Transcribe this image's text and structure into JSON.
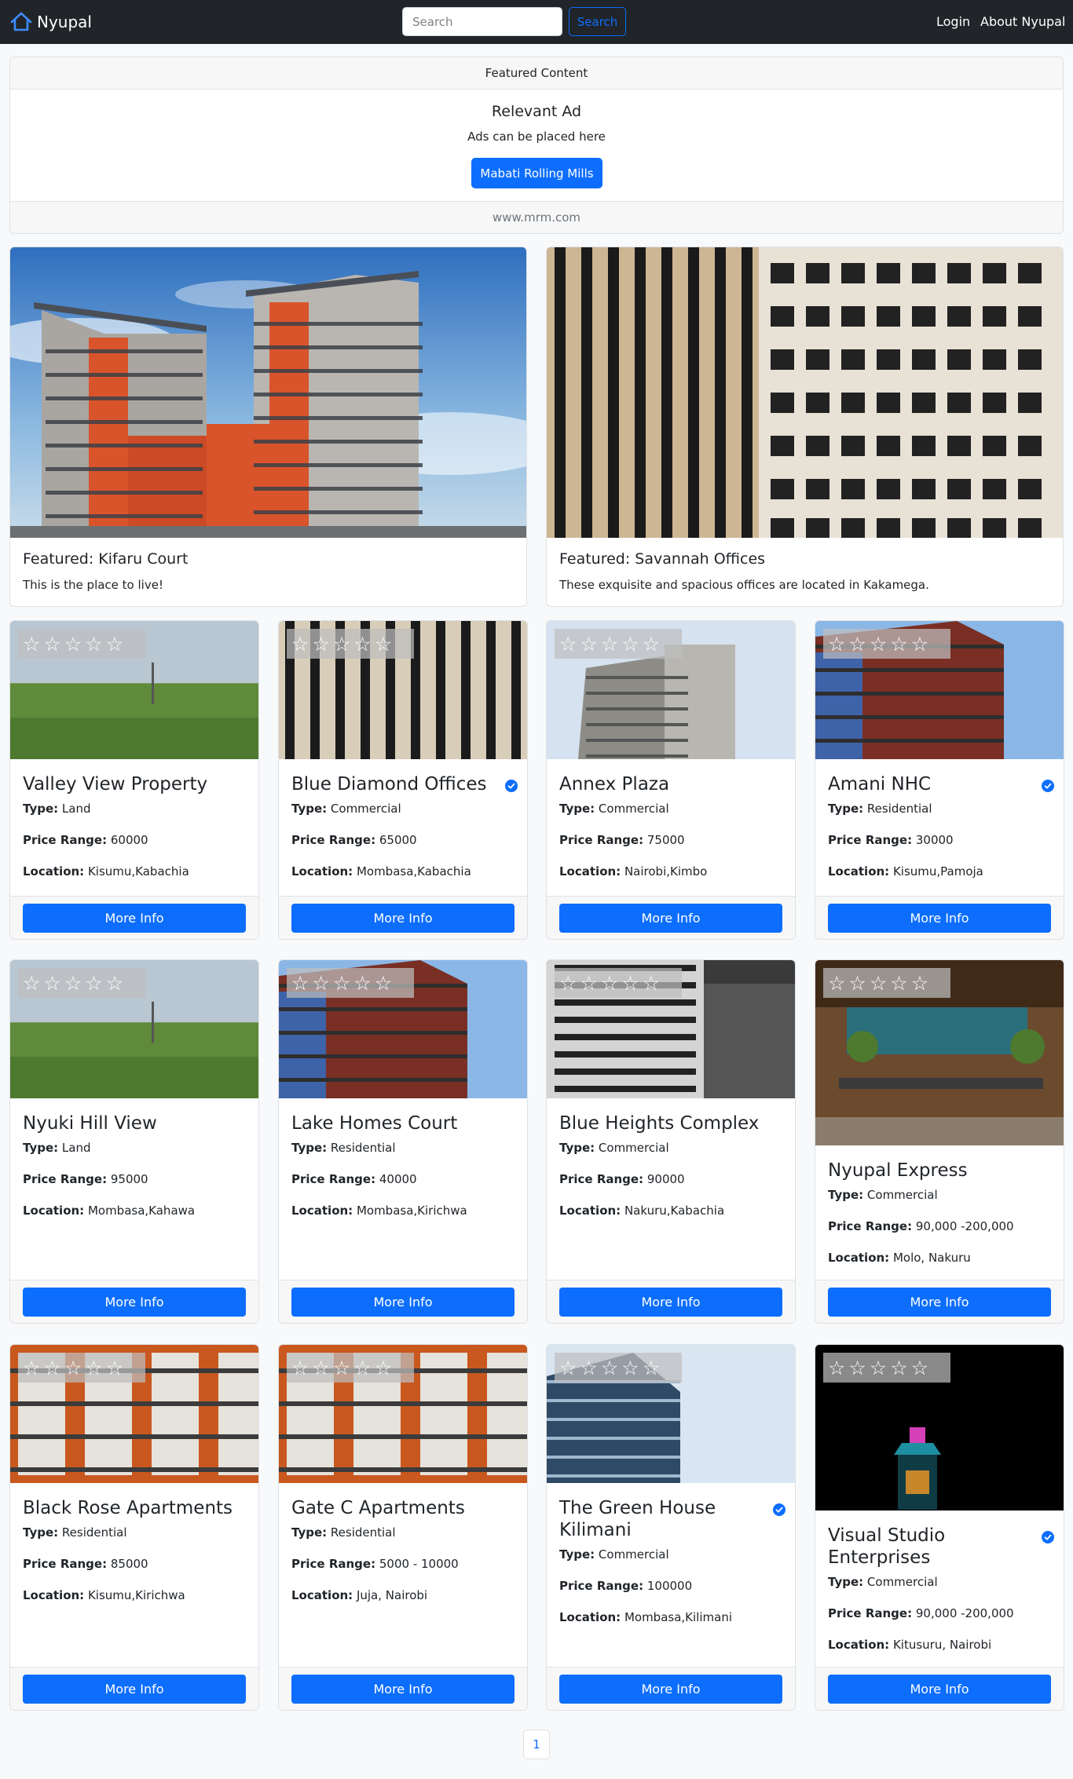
{
  "navbar": {
    "brand": "Nyupal",
    "search_placeholder": "Search",
    "search_button": "Search",
    "login": "Login",
    "about": "About Nyupal"
  },
  "ad": {
    "header": "Featured Content",
    "title": "Relevant Ad",
    "text": "Ads can be placed here",
    "button": "Mabati Rolling Mills",
    "footer": "www.mrm.com"
  },
  "featured": [
    {
      "title": "Featured: Kifaru Court",
      "text": "This is the place to live!"
    },
    {
      "title": "Featured: Savannah Offices",
      "text": "These exquisite and spacious offices are located in Kakamega."
    }
  ],
  "labels": {
    "type": "Type:",
    "price": "Price Range:",
    "location": "Location:",
    "more_info": "More Info"
  },
  "properties": [
    {
      "name": "Valley View Property",
      "type": "Land",
      "price": "60000",
      "location": "Kisumu,Kabachia",
      "verified": false
    },
    {
      "name": "Blue Diamond Offices",
      "type": "Commercial",
      "price": "65000",
      "location": "Mombasa,Kabachia",
      "verified": true
    },
    {
      "name": "Annex Plaza",
      "type": "Commercial",
      "price": "75000",
      "location": "Nairobi,Kimbo",
      "verified": false
    },
    {
      "name": "Amani NHC",
      "type": "Residential",
      "price": "30000",
      "location": "Kisumu,Pamoja",
      "verified": true
    },
    {
      "name": "Nyuki Hill View",
      "type": "Land",
      "price": "95000",
      "location": "Mombasa,Kahawa",
      "verified": false
    },
    {
      "name": "Lake Homes Court",
      "type": "Residential",
      "price": "40000",
      "location": "Mombasa,Kirichwa",
      "verified": false
    },
    {
      "name": "Blue Heights Complex",
      "type": "Commercial",
      "price": "90000",
      "location": "Nakuru,Kabachia",
      "verified": false
    },
    {
      "name": "Nyupal Express",
      "type": "Commercial",
      "price": "90,000 -200,000",
      "location": "Molo, Nakuru",
      "verified": false
    },
    {
      "name": "Black Rose Apartments",
      "type": "Residential",
      "price": "85000",
      "location": "Kisumu,Kirichwa",
      "verified": false
    },
    {
      "name": "Gate C Apartments",
      "type": "Residential",
      "price": "5000 - 10000",
      "location": "Juja, Nairobi",
      "verified": false
    },
    {
      "name": "The Green House Kilimani",
      "type": "Commercial",
      "price": "100000",
      "location": "Mombasa,Kilimani",
      "verified": true
    },
    {
      "name": "Visual Studio Enterprises",
      "type": "Commercial",
      "price": "90,000 -200,000",
      "location": "Kitusuru, Nairobi",
      "verified": true
    }
  ],
  "pagination": {
    "current": "1"
  },
  "colors": {
    "navbar": "#212529",
    "primary": "#0d6efd",
    "background": "#f8f9fa"
  }
}
